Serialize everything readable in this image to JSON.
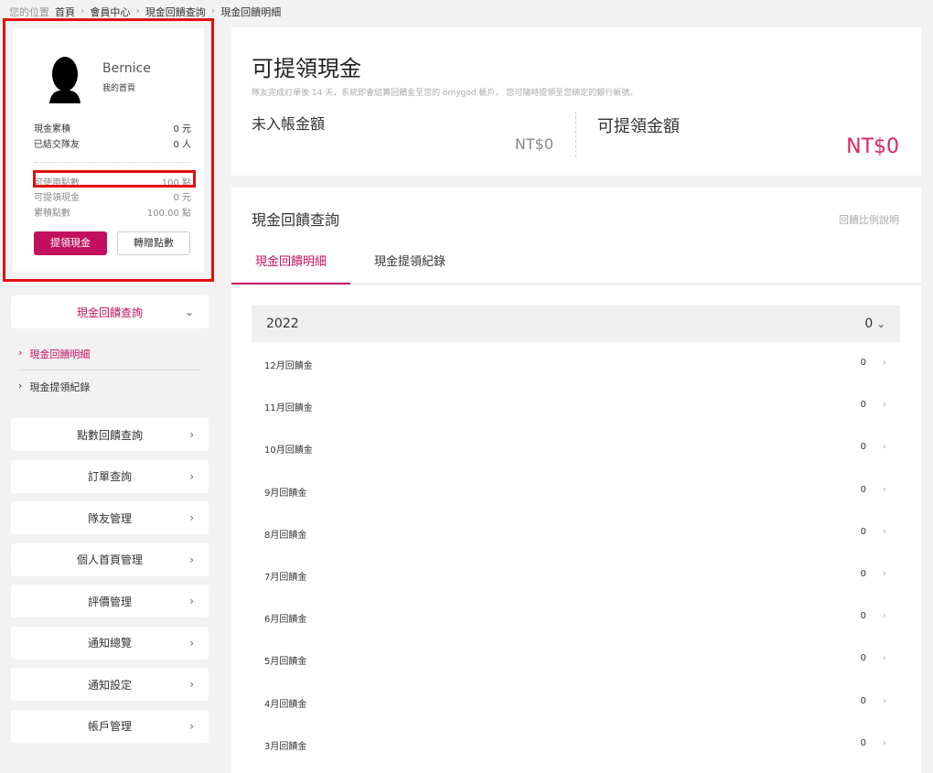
{
  "breadcrumb": {
    "label": "您的位置",
    "items": [
      "首頁",
      "會員中心",
      "現金回饋查詢",
      "現金回饋明細"
    ]
  },
  "profile": {
    "name": "Bernice",
    "link": "我的首頁",
    "stats": [
      {
        "label": "現金累積",
        "value": "0 元"
      },
      {
        "label": "已結交隊友",
        "value": "0 人"
      }
    ],
    "points": [
      {
        "label": "可使用點數",
        "value": "100 點"
      },
      {
        "label": "可提領現金",
        "value": "0 元"
      },
      {
        "label": "累積點數",
        "value": "100.00 點"
      }
    ],
    "withdraw_button": "提領現金",
    "transfer_button": "轉贈點數"
  },
  "sidebar": {
    "active": "現金回饋查詢",
    "subitems": [
      "現金回饋明細",
      "現金提領紀錄"
    ],
    "items": [
      "點數回饋查詢",
      "訂單查詢",
      "隊友管理",
      "個人首頁管理",
      "評價管理",
      "通知總覽",
      "通知設定",
      "帳戶管理"
    ]
  },
  "summary": {
    "title": "可提領現金",
    "desc": "隊友完成訂單後 14 天，系統即會結算回饋金至您的 omygod 帳戶， 您可隨時提領至您綁定的銀行帳號。",
    "pending_label": "未入帳金額",
    "pending_value": "NT$0",
    "available_label": "可提領金額",
    "available_value": "NT$0"
  },
  "detail": {
    "title": "現金回饋查詢",
    "help_link": "回饋比例說明",
    "tabs": [
      "現金回饋明細",
      "現金提領紀錄"
    ],
    "year": "2022",
    "year_total": "0",
    "months": [
      {
        "label": "12月回饋金",
        "value": "0"
      },
      {
        "label": "11月回饋金",
        "value": "0"
      },
      {
        "label": "10月回饋金",
        "value": "0"
      },
      {
        "label": "9月回饋金",
        "value": "0"
      },
      {
        "label": "8月回饋金",
        "value": "0"
      },
      {
        "label": "7月回饋金",
        "value": "0"
      },
      {
        "label": "6月回饋金",
        "value": "0"
      },
      {
        "label": "5月回饋金",
        "value": "0"
      },
      {
        "label": "4月回饋金",
        "value": "0"
      },
      {
        "label": "3月回饋金",
        "value": "0"
      }
    ]
  },
  "colors": {
    "accent": "#c3105e",
    "highlight": "#e31010"
  }
}
